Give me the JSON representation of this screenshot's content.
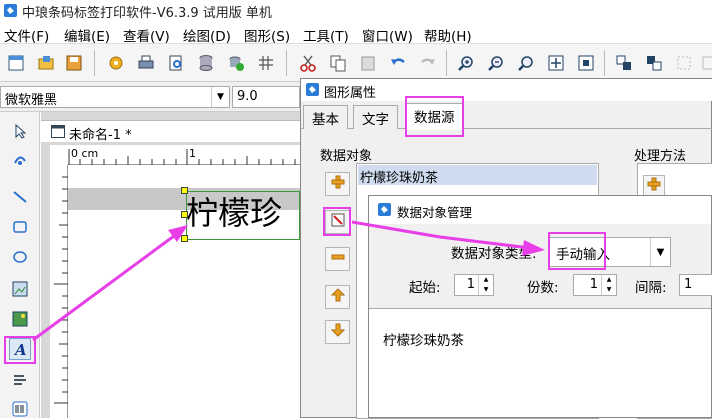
{
  "app": {
    "title": "中琅条码标签打印软件-V6.3.9 试用版 单机"
  },
  "menu": {
    "items": [
      "文件(F)",
      "编辑(E)",
      "查看(V)",
      "绘图(D)",
      "图形(S)",
      "工具(T)",
      "窗口(W)",
      "帮助(H)"
    ]
  },
  "fontbar": {
    "font": "微软雅黑",
    "size": "9.0"
  },
  "document": {
    "tab_title": "未命名-1 *",
    "ruler_label": "0 cm",
    "ruler_mark": "1",
    "label_text": "柠檬珍"
  },
  "graphic_props": {
    "title": "图形属性",
    "tabs": [
      "基本",
      "文字",
      "数据源"
    ],
    "data_object_label": "数据对象",
    "process_label": "处理方法",
    "data_item": "柠檬珍珠奶茶"
  },
  "data_mgr": {
    "title": "数据对象管理",
    "type_label": "数据对象类型:",
    "type_value": "手动输入",
    "start_label": "起始:",
    "start_value": "1",
    "copies_label": "份数:",
    "copies_value": "1",
    "interval_label": "间隔:",
    "interval_value": "1",
    "content": "柠檬珍珠奶茶"
  },
  "colors": {
    "annotation": "#e83ee8",
    "selection": "#cfdcef"
  }
}
